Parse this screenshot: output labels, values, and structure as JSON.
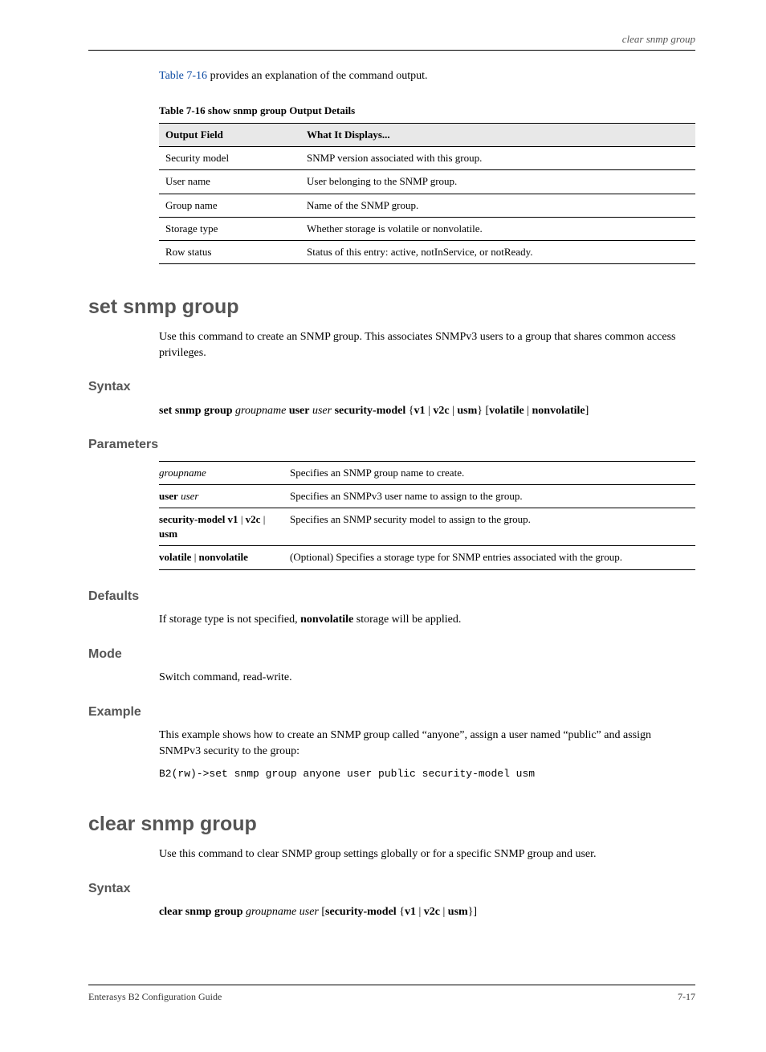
{
  "header": {
    "right": "clear snmp group"
  },
  "intro": {
    "link": "Table 7-16",
    "rest": " provides an explanation of the command output."
  },
  "outputTable": {
    "title": "Table 7-16    show snmp group Output Details",
    "head": [
      "Output Field",
      "What It Displays..."
    ],
    "rows": [
      [
        "Security model",
        "SNMP version associated with this group."
      ],
      [
        "User name",
        "User belonging to the SNMP group."
      ],
      [
        "Group name",
        "Name of the SNMP group."
      ],
      [
        "Storage type",
        "Whether storage is volatile or nonvolatile."
      ],
      [
        "Row status",
        "Status of this entry: active, notInService, or notReady."
      ]
    ]
  },
  "cmd1": {
    "title": "set snmp group",
    "desc": "Use this command to create an SNMP group. This associates SNMPv3 users to a group that shares common access privileges.",
    "syntaxLabel": "Syntax",
    "syntax_html": "<span class=\"kw\">set snmp group</span> <span class=\"it\">groupname</span> <span class=\"kw\">user</span> <span class=\"it\">user</span> <span class=\"kw\">security-model</span> {<span class=\"kw\">v1</span> | <span class=\"kw\">v2c</span> | <span class=\"kw\">usm</span>} [<span class=\"kw\">volatile</span> | <span class=\"kw\">nonvolatile</span>]",
    "paramsLabel": "Parameters",
    "params": [
      {
        "p": "<span class=\"i\">groupname</span>",
        "d": "Specifies an SNMP group name to create."
      },
      {
        "p": "<span class=\"b\">user</span> <span class=\"i\">user</span>",
        "d": "Specifies an SNMPv3 user name to assign to the group."
      },
      {
        "p": "<span class=\"b\">security-model v1</span> | <span class=\"b\">v2c</span> | <span class=\"b\">usm</span>",
        "d": "Specifies an SNMP security model to assign to the group."
      },
      {
        "p": "<span class=\"b\">volatile</span> | <span class=\"b\">nonvolatile</span>",
        "d": "(Optional) Specifies a storage type for SNMP entries associated with the group."
      }
    ],
    "defaultsLabel": "Defaults",
    "defaults_html": "If storage type is not specified, <b>nonvolatile</b> storage will be applied.",
    "modeLabel": "Mode",
    "mode": "Switch command, read-write.",
    "exampleLabel": "Example",
    "exampleText": "This example shows how to create an SNMP group called “anyone”, assign a user named “public” and assign SNMPv3 security to the group:",
    "exampleCode": "B2(rw)->set snmp group anyone user public security-model usm"
  },
  "cmd2": {
    "title": "clear snmp group",
    "desc": "Use this command to clear SNMP group settings globally or for a specific SNMP group and user.",
    "syntaxLabel": "Syntax",
    "syntax_html": "<span class=\"kw\">clear snmp group</span> <span class=\"it\">groupname user</span> [<span class=\"kw\">security-model</span> {<span class=\"kw\">v1</span> | <span class=\"kw\">v2c</span> | <span class=\"kw\">usm</span>}]"
  },
  "footer": {
    "left": "Enterasys B2 Configuration Guide",
    "right": "7-17"
  }
}
